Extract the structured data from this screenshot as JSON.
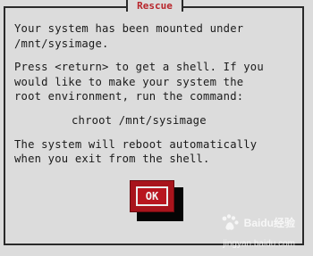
{
  "dialog": {
    "title": "Rescue",
    "message_lines": [
      "Your system has been mounted under",
      "/mnt/sysimage.",
      "Press <return> to get a shell. If you",
      "would like to make your system the",
      "root environment, run the command:",
      "chroot /mnt/sysimage",
      "The system will reboot automatically",
      "when you exit from the shell."
    ],
    "ok_label": "OK"
  },
  "watermark": {
    "brand": "Baidu经验",
    "url": "jingyan.baidu.com",
    "icon": "baidu-paw-icon"
  },
  "colors": {
    "background": "#dcdcdc",
    "accent": "#b8161f",
    "text": "#1a1a1a",
    "title": "#b8252b"
  }
}
